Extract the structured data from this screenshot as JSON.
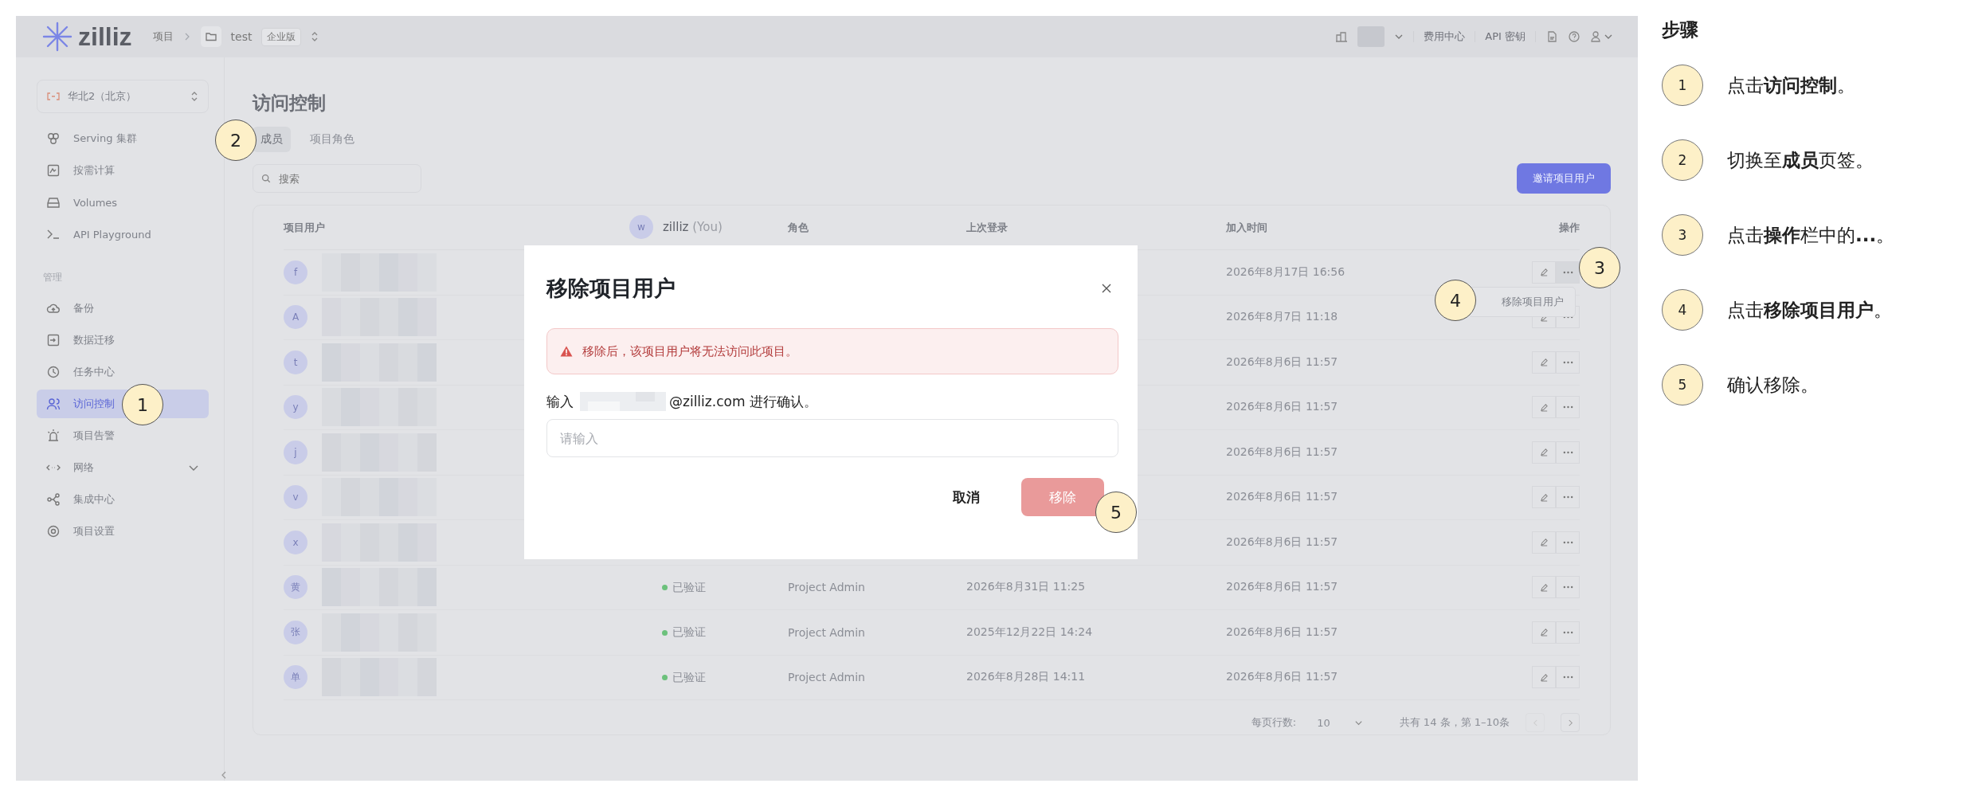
{
  "topbar": {
    "logo": "zilliz",
    "breadcrumb": "项目",
    "project": "test",
    "plan_badge": "企业版",
    "links": [
      "费用中心",
      "API 密钥"
    ]
  },
  "sidebar": {
    "region": "华北2（北京）",
    "groups": [
      {
        "items": [
          {
            "label": "Serving 集群",
            "selected": false
          },
          {
            "label": "按需计算",
            "selected": false
          },
          {
            "label": "Volumes",
            "selected": false
          },
          {
            "label": "API Playground",
            "selected": false
          }
        ]
      },
      {
        "title": "管理",
        "items": [
          {
            "label": "备份",
            "selected": false
          },
          {
            "label": "数据迁移",
            "selected": false
          },
          {
            "label": "任务中心",
            "selected": false
          },
          {
            "label": "访问控制",
            "selected": true
          },
          {
            "label": "项目告警",
            "selected": false
          },
          {
            "label": "网络",
            "selected": false,
            "expandable": true
          },
          {
            "label": "集成中心",
            "selected": false
          },
          {
            "label": "项目设置",
            "selected": false
          }
        ]
      }
    ]
  },
  "page": {
    "title": "访问控制",
    "tabs": [
      {
        "label": "成员",
        "selected": true
      },
      {
        "label": "项目角色",
        "selected": false
      }
    ],
    "search": {
      "placeholder": "搜索"
    },
    "invite_button": "邀请项目用户"
  },
  "table": {
    "columns": [
      "项目用户",
      "角色",
      "上次登录",
      "加入时间",
      "操作"
    ],
    "floating_user": {
      "avatar": "w",
      "name": "zilliz",
      "suffix": "(You)"
    },
    "rows": [
      {
        "avatar": "f",
        "joined": "2026年8月17日 16:56"
      },
      {
        "avatar": "A",
        "joined": "2026年8月7日 11:18"
      },
      {
        "avatar": "t",
        "joined": "2026年8月6日 11:57"
      },
      {
        "avatar": "y",
        "joined": "2026年8月6日 11:57"
      },
      {
        "avatar": "j",
        "joined": "2026年8月6日 11:57"
      },
      {
        "avatar": "v",
        "joined": "2026年8月6日 11:57"
      },
      {
        "avatar": "x",
        "joined": "2026年8月6日 11:57"
      },
      {
        "avatar": "黄",
        "status": "已验证",
        "role": "Project Admin",
        "last_login": "2026年8月31日 11:25",
        "joined": "2026年8月6日 11:57"
      },
      {
        "avatar": "张",
        "status": "已验证",
        "role": "Project Admin",
        "last_login": "2025年12月22日 14:24",
        "joined": "2026年8月6日 11:57"
      },
      {
        "avatar": "单",
        "status": "已验证",
        "role": "Project Admin",
        "last_login": "2026年8月28日 14:11",
        "joined": "2026年8月6日 11:57"
      }
    ],
    "row_menu": {
      "item": "移除项目用户"
    },
    "pagination": {
      "rows_label": "每页行数:",
      "rows_value": "10",
      "summary": "共有 14 条，第 1–10条"
    }
  },
  "modal": {
    "title": "移除项目用户",
    "alert": "移除后，该项目用户将无法访问此项目。",
    "prompt_prefix": "输入",
    "prompt_suffix": "@zilliz.com 进行确认。",
    "input": {
      "placeholder": "请输入"
    },
    "cancel": "取消",
    "confirm": {
      "label": "移除",
      "disabled": true
    }
  },
  "callouts": [
    "1",
    "2",
    "3",
    "4",
    "5"
  ],
  "steps": {
    "title": "步骤",
    "items": [
      {
        "number": "1",
        "text": "点击**访问控制**。"
      },
      {
        "number": "2",
        "text": "切换至**成员**页签。"
      },
      {
        "number": "3",
        "text": "点击**操作**栏中的**...**。"
      },
      {
        "number": "4",
        "text": "点击**移除项目用户**。"
      },
      {
        "number": "5",
        "text": "确认移除。"
      }
    ]
  }
}
